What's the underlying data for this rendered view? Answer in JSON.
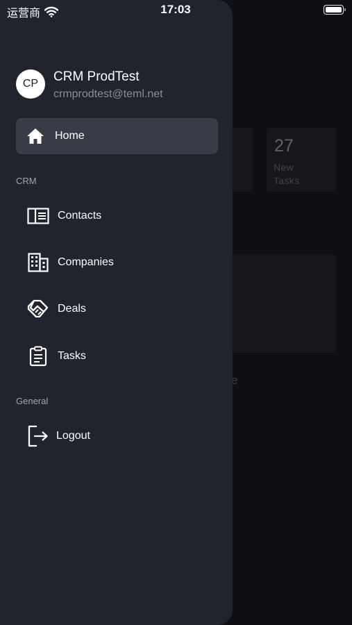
{
  "status_bar": {
    "carrier": "运营商",
    "time": "17:03",
    "wifi_icon": "wifi-icon",
    "battery_icon": "battery-icon"
  },
  "background": {
    "stat_number": "27",
    "stat_label_line1": "New",
    "stat_label_line2": "Tasks",
    "fragment_1": "s",
    "fragment_2": "e"
  },
  "drawer": {
    "user": {
      "initials": "CP",
      "name": "CRM ProdTest",
      "email": "crmprodtest@teml.net"
    },
    "home": {
      "label": "Home",
      "icon": "home-icon"
    },
    "sections": [
      {
        "title": "CRM",
        "items": [
          {
            "label": "Contacts",
            "icon": "contacts-icon"
          },
          {
            "label": "Companies",
            "icon": "companies-icon"
          },
          {
            "label": "Deals",
            "icon": "deals-icon"
          },
          {
            "label": "Tasks",
            "icon": "tasks-icon"
          }
        ]
      },
      {
        "title": "General",
        "items": [
          {
            "label": "Logout",
            "icon": "logout-icon"
          }
        ]
      }
    ]
  },
  "colors": {
    "drawer_bg": "#22242d",
    "active_item_bg": "#393c47",
    "screen_bg": "#0f1013",
    "secondary_text": "#8a8d96"
  }
}
